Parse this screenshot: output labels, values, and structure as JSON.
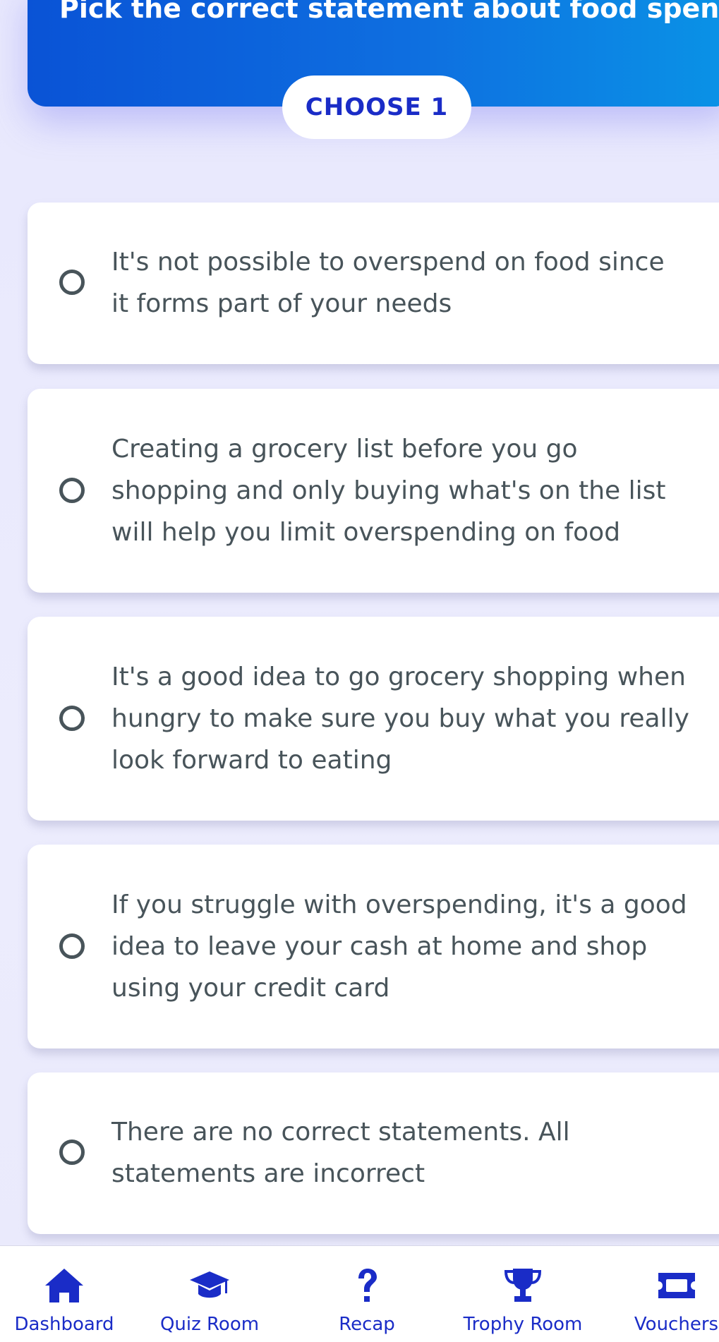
{
  "question": {
    "text": "Pick the correct statement about food spend.",
    "instruction": "CHOOSE 1"
  },
  "options": [
    {
      "line1": "It's not possible to overspend on food since",
      "line2": "it forms part of your needs",
      "line3": "",
      "selected": false
    },
    {
      "line1": "Creating a grocery list before you go",
      "line2": "shopping and only buying what's on the list",
      "line3": "will help you limit overspending on food",
      "selected": false
    },
    {
      "line1": "It's a good idea to go grocery shopping when",
      "line2": "hungry to make sure you buy what you really",
      "line3": "look forward to eating",
      "selected": false
    },
    {
      "line1": "If you struggle with overspending, it's a good",
      "line2": "idea to leave your cash at home and shop",
      "line3": "using your credit card",
      "selected": false
    },
    {
      "line1": "There are no correct statements. All",
      "line2": "statements are incorrect",
      "line3": "",
      "selected": false
    }
  ],
  "nav": {
    "items": [
      {
        "label": "Dashboard",
        "icon": "home-icon"
      },
      {
        "label": "Quiz Room",
        "icon": "graduation-cap-icon"
      },
      {
        "label": "Recap",
        "icon": "question-mark-icon"
      },
      {
        "label": "Trophy Room",
        "icon": "trophy-icon"
      },
      {
        "label": "Vouchers",
        "icon": "ticket-icon"
      }
    ]
  },
  "colors": {
    "accent": "#1a2cc7",
    "header_gradient_start": "#0a53d6",
    "header_gradient_end": "#0a93e6",
    "option_text": "#48545a",
    "background": "#ebebfd"
  }
}
